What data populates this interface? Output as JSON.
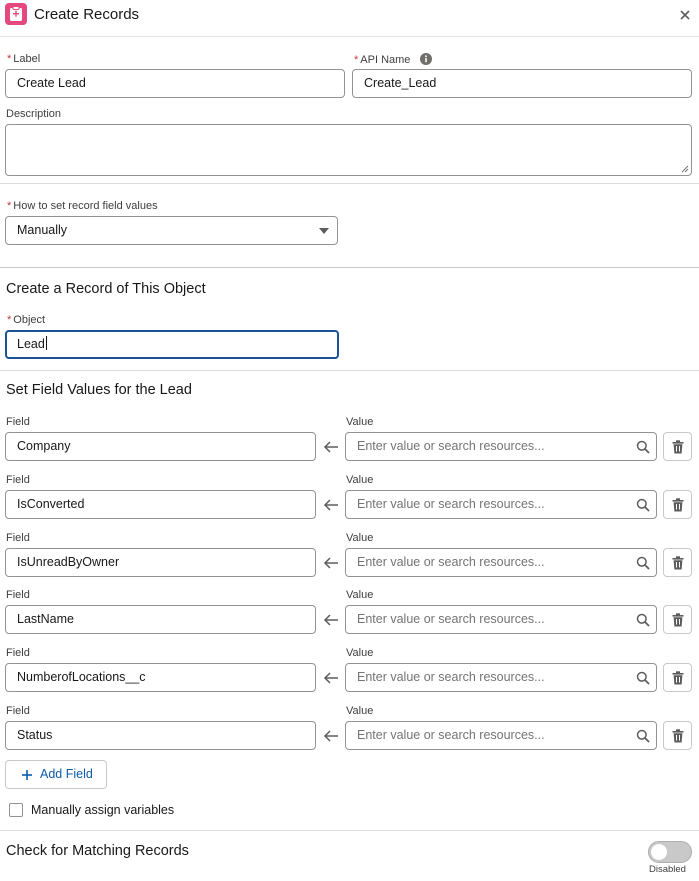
{
  "header": {
    "title": "Create Records",
    "app_icon": "clipboard-icon",
    "close_icon": "close-icon"
  },
  "form": {
    "label_label": "Label",
    "label_value": "Create Lead",
    "api_label": "API Name",
    "api_value": "Create_Lead",
    "description_label": "Description",
    "how_label": "How to set record field values",
    "how_value": "Manually"
  },
  "object_section": {
    "title": "Create a Record of This Object",
    "object_label": "Object",
    "object_value": "Lead"
  },
  "fields_section": {
    "title": "Set Field Values for the Lead",
    "field_header": "Field",
    "value_header": "Value",
    "value_placeholder": "Enter value or search resources...",
    "rows": [
      {
        "field": "Company"
      },
      {
        "field": "IsConverted"
      },
      {
        "field": "IsUnreadByOwner"
      },
      {
        "field": "LastName"
      },
      {
        "field": "NumberofLocations__c"
      },
      {
        "field": "Status"
      }
    ],
    "add_field_label": "Add Field",
    "manual_assign_label": "Manually assign variables"
  },
  "matching": {
    "title": "Check for Matching Records",
    "toggle_state": "Disabled"
  },
  "colors": {
    "accent": "#0b5cab",
    "focus": "#1b5297",
    "required": "#c23934",
    "app": "#e4487d"
  }
}
